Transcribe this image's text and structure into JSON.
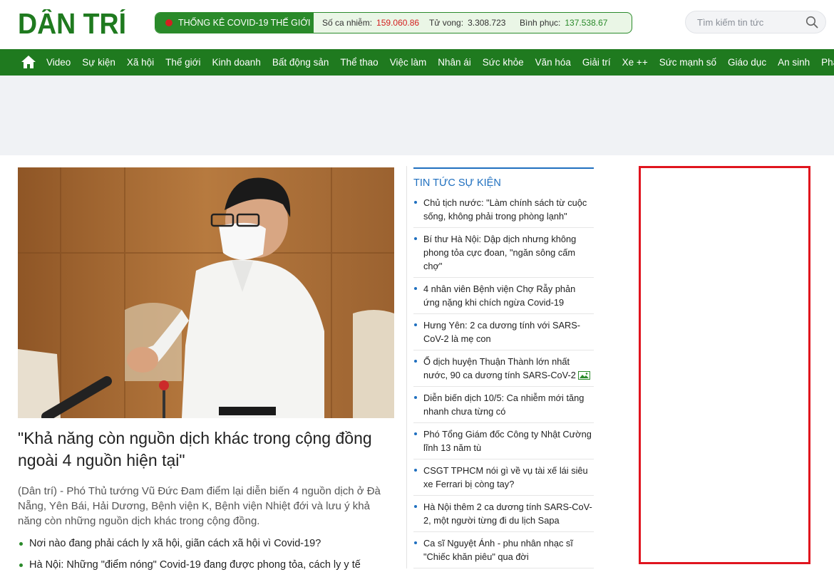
{
  "brand": {
    "logo_text": "DÂN TRÍ",
    "color": "#1f7a1f"
  },
  "covid": {
    "title": "THỐNG KÊ COVID-19 THẾ GIỚI",
    "cases_label": "Số ca nhiễm:",
    "cases_value": "159.060.86",
    "deaths_label": "Tử vong:",
    "deaths_value": "3.308.723",
    "recovered_label": "Bình phục:",
    "recovered_value": "137.538.67"
  },
  "search": {
    "placeholder": "Tìm kiếm tin tức",
    "icon": "search-icon"
  },
  "nav": {
    "home_icon": "home-icon",
    "items": [
      "Video",
      "Sự kiện",
      "Xã hội",
      "Thế giới",
      "Kinh doanh",
      "Bất động sản",
      "Thể thao",
      "Việc làm",
      "Nhân ái",
      "Sức khỏe",
      "Văn hóa",
      "Giải trí",
      "Xe ++",
      "Sức mạnh số",
      "Giáo dục",
      "An sinh",
      "Pháp luật"
    ]
  },
  "feature": {
    "title": "\"Khả năng còn nguồn dịch khác trong cộng đồng ngoài 4 nguồn hiện tại\"",
    "sapo": "(Dân trí) - Phó Thủ tướng Vũ Đức Đam điểm lại diễn biến 4 nguồn dịch ở Đà Nẵng, Yên Bái, Hải Dương, Bệnh viện K, Bệnh viện Nhiệt đới và lưu ý khả năng còn những nguồn dịch khác trong cộng đồng.",
    "related": [
      "Nơi nào đang phải cách ly xã hội, giãn cách xã hội vì Covid-19?",
      "Hà Nội: Những \"điểm nóng\" Covid-19 đang được phong tỏa, cách ly y tế"
    ]
  },
  "news_col": {
    "heading": "TIN TỨC SỰ KIỆN",
    "items": [
      "Chủ tịch nước: \"Làm chính sách từ cuộc sống, không phải trong phòng lạnh\"",
      "Bí thư Hà Nội: Dập dịch nhưng không phong tỏa cực đoan, \"ngăn sông cấm chợ\"",
      "4 nhân viên Bệnh viện Chợ Rẫy phản ứng nặng khi chích ngừa Covid-19",
      "Hưng Yên: 2 ca dương tính với SARS-CoV-2 là mẹ con",
      "Ổ dịch huyện Thuận Thành lớn nhất nước, 90 ca dương tính SARS-CoV-2",
      "Diễn biến dịch 10/5: Ca nhiễm mới tăng nhanh chưa từng có",
      "Phó Tổng Giám đốc Công ty Nhật Cường lĩnh 13 năm tù",
      "CSGT TPHCM nói gì về vụ tài xế lái siêu xe Ferrari bị còng tay?",
      "Hà Nội thêm 2 ca dương tính SARS-CoV-2, một người từng đi du lịch Sapa",
      "Ca sĩ Nguyệt Ánh - phu nhân nhạc sĩ \"Chiếc khăn piêu\" qua đời"
    ]
  }
}
